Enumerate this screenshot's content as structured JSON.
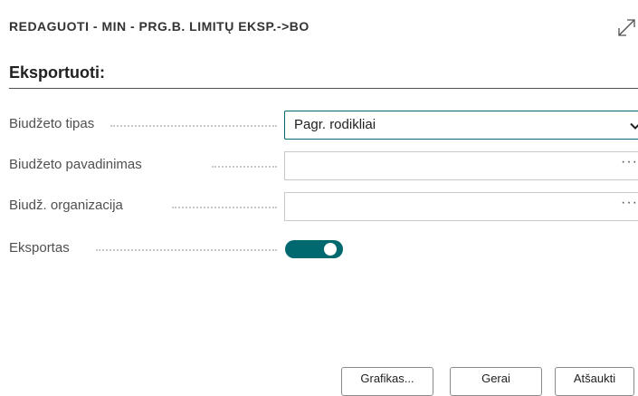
{
  "dialog": {
    "title": "REDAGUOTI - MIN - PRG.B. LIMITŲ EKSP.->BO",
    "expand_icon": "expand-diagonal-arrow-icon"
  },
  "section": {
    "title": "Eksportuoti:"
  },
  "fields": [
    {
      "label": "Biudžeto tipas",
      "value": "Pagr. rodikliai",
      "control": "dropdown",
      "icon": "chevron-down-icon"
    },
    {
      "label": "Biudžeto pavadinimas",
      "value": "",
      "control": "lookup",
      "icon": "ellipsis-icon",
      "icon_text": "···"
    },
    {
      "label": "Biudž. organizacija",
      "value": "",
      "control": "lookup",
      "icon": "ellipsis-icon",
      "icon_text": "···"
    },
    {
      "label": "Eksportas",
      "value": true,
      "control": "toggle"
    }
  ],
  "buttons": {
    "schedule": "Grafikas...",
    "ok": "Gerai",
    "cancel": "Atšaukti"
  },
  "colors": {
    "accent": "#00696f",
    "text": "#212121",
    "label": "#505050",
    "border": "#c8c8c8"
  }
}
